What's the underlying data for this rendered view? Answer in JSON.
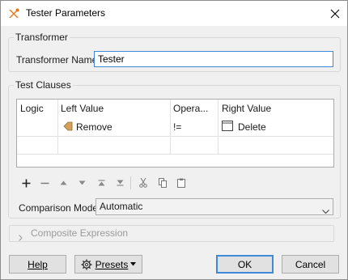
{
  "window": {
    "title": "Tester Parameters"
  },
  "transformer": {
    "group_label": "Transformer",
    "name_label": "Transformer Name:",
    "name_value": "Tester"
  },
  "test_clauses": {
    "group_label": "Test Clauses",
    "columns": [
      "Logic",
      "Left Value",
      "Opera...",
      "Right Value"
    ],
    "rows": [
      {
        "logic": "",
        "left": "Remove",
        "left_icon": "attribute-icon",
        "operator": "!=",
        "right": "Delete",
        "right_icon": "text-value-icon"
      }
    ]
  },
  "toolbar": {
    "buttons": [
      "add-icon",
      "remove-icon",
      "move-up-icon",
      "move-down-icon",
      "move-top-icon",
      "move-bottom-icon",
      "cut-icon",
      "copy-icon",
      "paste-icon"
    ]
  },
  "comparison": {
    "label": "Comparison Mode:",
    "value": "Automatic"
  },
  "composite": {
    "label": "Composite Expression"
  },
  "buttons": {
    "help": "Help",
    "presets": "Presets",
    "ok": "OK",
    "cancel": "Cancel"
  },
  "colors": {
    "accent": "#3c8ad8",
    "attribute_icon": "#d4a05a"
  }
}
